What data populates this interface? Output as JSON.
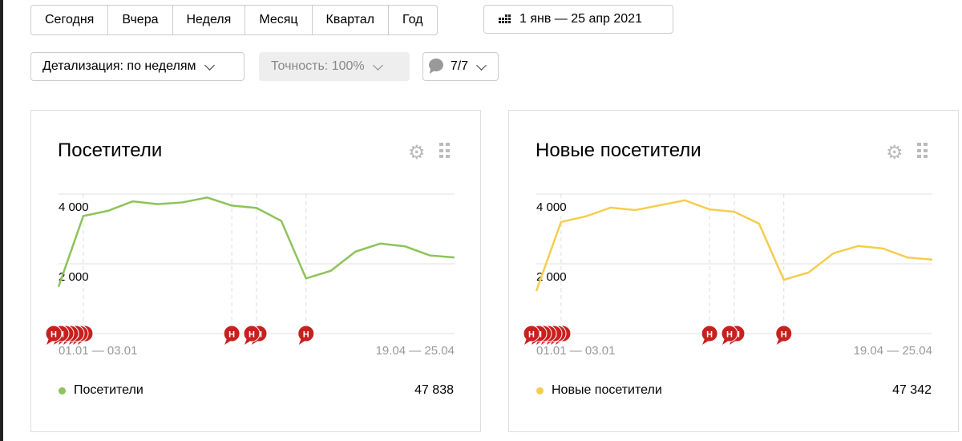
{
  "periods": [
    "Сегодня",
    "Вчера",
    "Неделя",
    "Месяц",
    "Квартал",
    "Год"
  ],
  "date_range": {
    "icon": "calendar-icon",
    "label": "1 янв — 25 апр 2021"
  },
  "detail": {
    "label": "Детализация: по неделям"
  },
  "accuracy": {
    "label": "Точность: 100%"
  },
  "notes": {
    "icon": "comment-icon",
    "label": "7/7"
  },
  "chart_data": [
    {
      "type": "line",
      "title": "Посетители",
      "color": "#8dc35a",
      "yticks": [
        "2 000",
        "4 000"
      ],
      "ylim": [
        0,
        4000
      ],
      "x_first": "01.01 — 03.01",
      "x_last": "19.04 — 25.04",
      "values": [
        1340,
        3370,
        3520,
        3790,
        3710,
        3760,
        3900,
        3670,
        3600,
        3230,
        1580,
        1800,
        2350,
        2580,
        2500,
        2240,
        2180
      ],
      "annotation_weeks": [
        1,
        7,
        8,
        10
      ],
      "legend": "Посетители",
      "total": "47 838"
    },
    {
      "type": "line",
      "title": "Новые посетители",
      "color": "#f5cd4f",
      "yticks": [
        "2 000",
        "4 000"
      ],
      "ylim": [
        0,
        4000
      ],
      "x_first": "01.01 — 03.01",
      "x_last": "19.04 — 25.04",
      "values": [
        1220,
        3200,
        3360,
        3610,
        3540,
        3680,
        3820,
        3560,
        3490,
        3150,
        1540,
        1750,
        2300,
        2510,
        2440,
        2180,
        2120
      ],
      "annotation_weeks": [
        1,
        7,
        8,
        10
      ],
      "legend": "Новые посетители",
      "total": "47 342"
    }
  ],
  "marker_letter": "Н",
  "marker_color": "#c8201f"
}
